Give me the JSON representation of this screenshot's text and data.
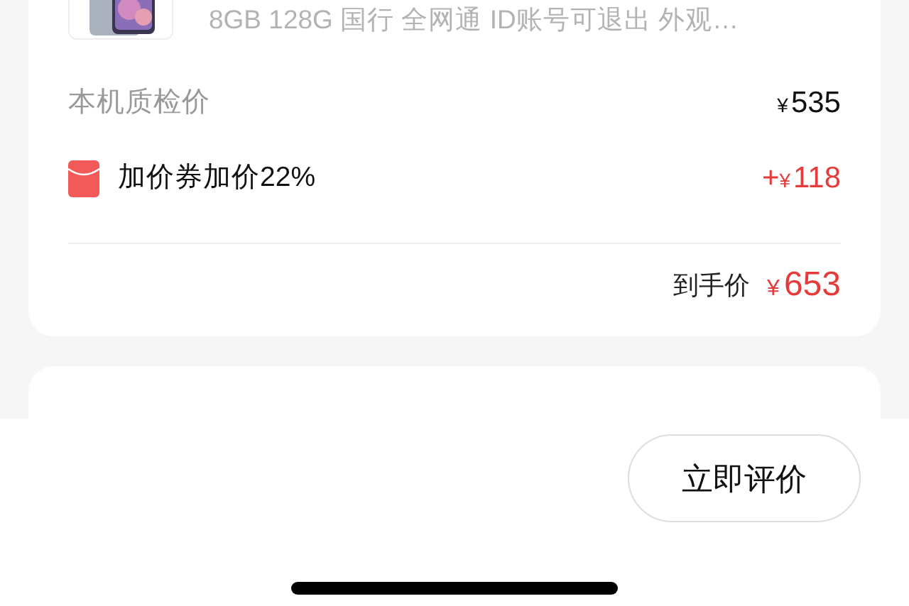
{
  "product": {
    "kind": "picture",
    "specs": "8GB 128G 国行 全网通 ID账号可退出 外观…"
  },
  "price_rows": [
    {
      "kind": "plain",
      "label": "本机质检价",
      "sign": "",
      "currency": "¥",
      "amount": "535",
      "highlight": false
    },
    {
      "kind": "coupon",
      "label": "加价券加价22%",
      "sign": "+",
      "currency": "¥",
      "amount": "118",
      "highlight": true
    }
  ],
  "total": {
    "label": "到手价",
    "currency": "¥",
    "amount": "653"
  },
  "bottom_bar": {
    "button": "立即评价"
  }
}
